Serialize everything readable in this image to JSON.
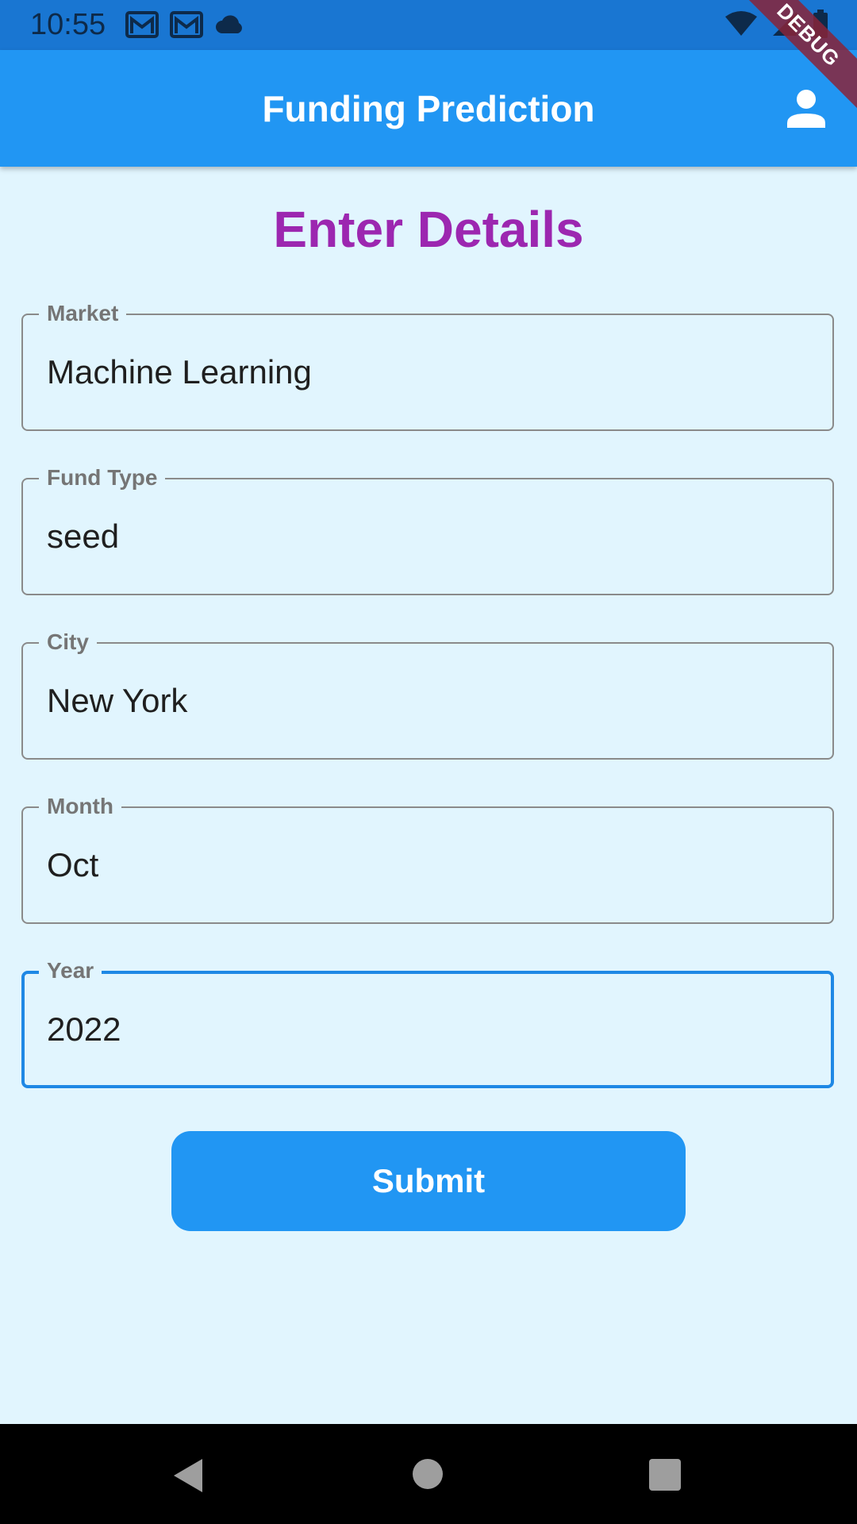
{
  "status_bar": {
    "time": "10:55",
    "left_icons": [
      "gmail-icon",
      "gmail-icon",
      "cloud-icon"
    ],
    "right_icons": [
      "wifi-icon",
      "signal-icon",
      "battery-icon"
    ]
  },
  "app_bar": {
    "title": "Funding Prediction",
    "profile_icon": "person-icon",
    "debug_banner": "DEBUG"
  },
  "form": {
    "heading": "Enter Details",
    "fields": [
      {
        "label": "Market",
        "value": "Machine Learning"
      },
      {
        "label": "Fund Type",
        "value": "seed"
      },
      {
        "label": "City",
        "value": "New York"
      },
      {
        "label": "Month",
        "value": "Oct"
      },
      {
        "label": "Year",
        "value": "2022"
      }
    ],
    "submit_label": "Submit"
  },
  "nav_bar": {
    "icons": [
      "back-icon",
      "home-icon",
      "recents-icon"
    ]
  },
  "colors": {
    "background": "#E1F5FE",
    "app_bar": "#2196F3",
    "status_bar": "#1976D2",
    "heading": "#9C27B0",
    "focused_border": "#1E88E5"
  }
}
